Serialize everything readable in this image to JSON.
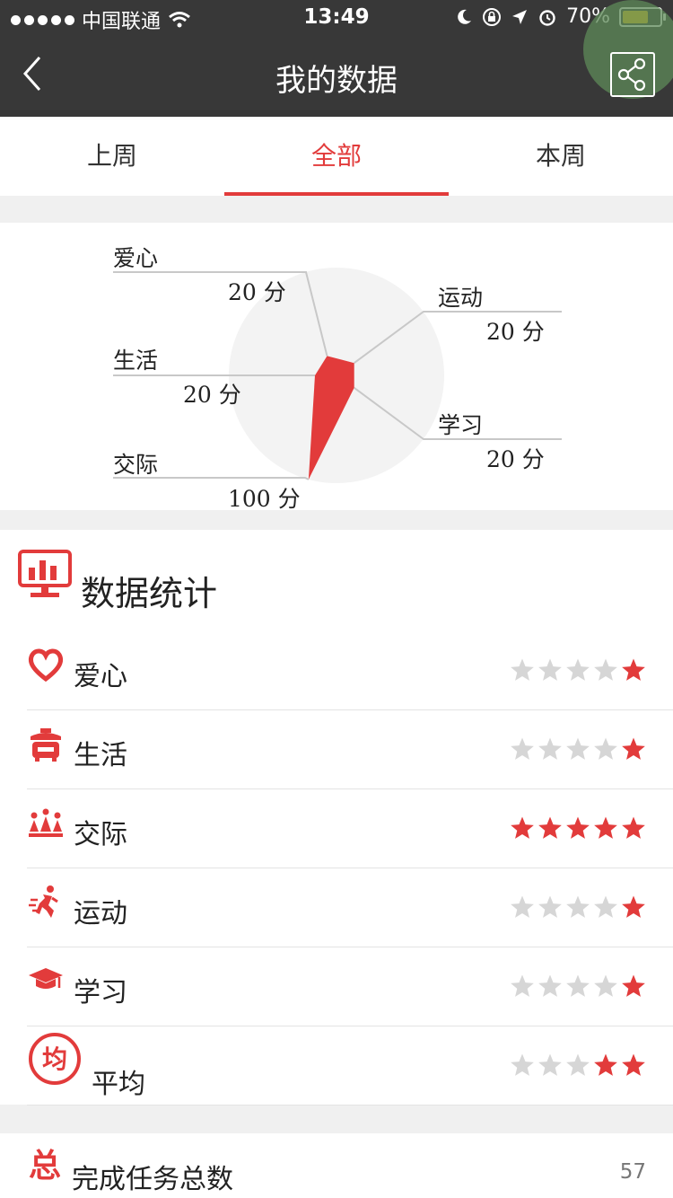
{
  "status": {
    "carrier": "中国联通",
    "time": "13:49",
    "battery": "70%",
    "battery_level": 0.7
  },
  "header": {
    "title": "我的数据"
  },
  "tabs": [
    {
      "label": "上周",
      "active": false
    },
    {
      "label": "全部",
      "active": true
    },
    {
      "label": "本周",
      "active": false
    }
  ],
  "chart_data": {
    "type": "radar",
    "unit": "分",
    "categories": [
      "爱心",
      "运动",
      "学习",
      "交际",
      "生活"
    ],
    "values": [
      20,
      20,
      20,
      100,
      20
    ],
    "labels": {
      "aixin": {
        "name": "爱心",
        "value": "20 分"
      },
      "yundong": {
        "name": "运动",
        "value": "20 分"
      },
      "shenghuo": {
        "name": "生活",
        "value": "20 分"
      },
      "xuexi": {
        "name": "学习",
        "value": "20 分"
      },
      "jiaoji": {
        "name": "交际",
        "value": "100 分"
      }
    },
    "max": 100,
    "color": "#e23b3b"
  },
  "stats": {
    "title": "数据统计",
    "rows": [
      {
        "label": "爱心",
        "icon": "heart-icon",
        "stars": 1
      },
      {
        "label": "生活",
        "icon": "rice-cooker-icon",
        "stars": 1
      },
      {
        "label": "交际",
        "icon": "crowd-icon",
        "stars": 5
      },
      {
        "label": "运动",
        "icon": "runner-icon",
        "stars": 1
      },
      {
        "label": "学习",
        "icon": "graduation-cap-icon",
        "stars": 1
      },
      {
        "label": "平均",
        "icon": "average-badge-icon",
        "stars": 2,
        "badge": "均"
      }
    ]
  },
  "total": {
    "label": "完成任务总数",
    "value": "57",
    "badge": "总"
  },
  "colors": {
    "accent": "#e23b3b",
    "star_off": "#d6d6d6",
    "bar": "#383838"
  }
}
